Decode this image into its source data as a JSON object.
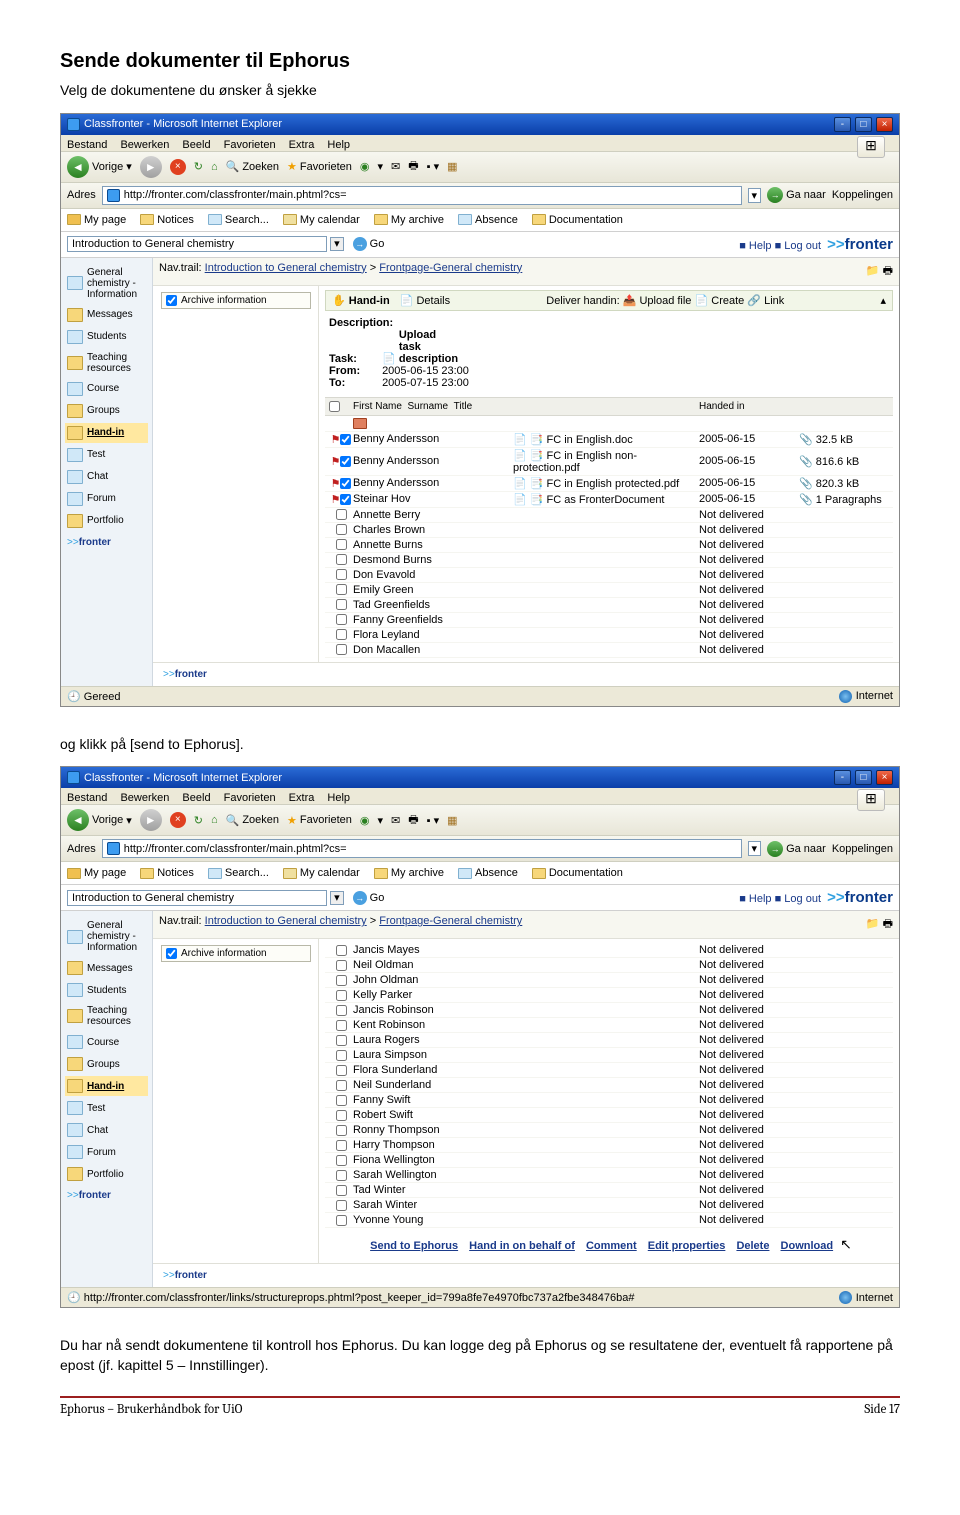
{
  "doc": {
    "title": "Sende dokumenter til  Ephorus",
    "intro": "Velg de dokumentene du ønsker å sjekke",
    "mid1": "og klikk på [send to Ephorus].",
    "outro": "Du har nå sendt dokumentene til kontroll hos Ephorus. Du kan logge deg på Ephorus og se resultatene der, eventuelt få rapportene på epost (jf. kapittel 5 – Innstillinger).",
    "foot_left": "Ephorus – Brukerhåndbok for UiO",
    "foot_right": "Side 17"
  },
  "browser": {
    "title": "Classfronter - Microsoft Internet Explorer",
    "menus": [
      "Bestand",
      "Bewerken",
      "Beeld",
      "Favorieten",
      "Extra",
      "Help"
    ],
    "back": "Vorige",
    "search": "Zoeken",
    "fav": "Favorieten",
    "addr_label": "Adres",
    "url": "http://fronter.com/classfronter/main.phtml?cs=",
    "url2": "http://fronter.com/classfronter/links/structureprops.phtml?post_keeper_id=799a8fe7e4970fbc737a2fbe348476ba#",
    "go": "Ga naar",
    "koppel": "Koppelingen",
    "status_left": "Gereed",
    "status_right": "Internet"
  },
  "fronter": {
    "nav": [
      "My page",
      "Notices",
      "Search...",
      "My calendar",
      "My archive",
      "Absence",
      "Documentation"
    ],
    "course": "Introduction to General chemistry",
    "go": "Go",
    "help": "Help",
    "logout": "Log out",
    "logo": "fronter",
    "navtrail_label": "Nav.trail:",
    "navtrail1": "Introduction to General chemistry",
    "navtrail2": "Frontpage-General chemistry",
    "archive": "Archive information"
  },
  "sidebar": [
    {
      "label": "General chemistry - Information",
      "ico": "alt"
    },
    {
      "label": "Messages",
      "ico": "f"
    },
    {
      "label": "Students",
      "ico": "alt"
    },
    {
      "label": "Teaching resources",
      "ico": "f"
    },
    {
      "label": "Course",
      "ico": "alt"
    },
    {
      "label": "Groups",
      "ico": "f"
    },
    {
      "label": "Hand-in",
      "ico": "hand"
    },
    {
      "label": "Test",
      "ico": "alt"
    },
    {
      "label": "Chat",
      "ico": "alt"
    },
    {
      "label": "Forum",
      "ico": "alt"
    },
    {
      "label": "Portfolio",
      "ico": "f"
    }
  ],
  "handin": {
    "title": "Hand-in",
    "details": "Details",
    "deliver": "Deliver handin:",
    "upload": "Upload file",
    "create": "Create",
    "link": "Link",
    "desc_label": "Description:",
    "task_label": "Task:",
    "task": "Upload task description",
    "from_label": "From:",
    "from": "2005-06-15 23:00",
    "to_label": "To:",
    "to": "2005-07-15 23:00",
    "cols": {
      "fn": "First Name",
      "sn": "Surname",
      "ti": "Title",
      "hi": "Handed in"
    }
  },
  "rows1": [
    {
      "ck": true,
      "flag": true,
      "name": "Benny Andersson",
      "title": "FC in English.doc",
      "date": "2005-06-15",
      "size": "32.5 kB"
    },
    {
      "ck": true,
      "flag": true,
      "name": "Benny Andersson",
      "title": "FC in English non-protection.pdf",
      "date": "2005-06-15",
      "size": "816.6 kB"
    },
    {
      "ck": true,
      "flag": true,
      "name": "Benny Andersson",
      "title": "FC in English protected.pdf",
      "date": "2005-06-15",
      "size": "820.3 kB"
    },
    {
      "ck": true,
      "flag": true,
      "name": "Steinar Hov",
      "title": "FC as FronterDocument",
      "date": "2005-06-15",
      "size": "1 Paragraphs"
    },
    {
      "ck": false,
      "name": "Annette Berry",
      "status": "Not delivered"
    },
    {
      "ck": false,
      "name": "Charles Brown",
      "status": "Not delivered"
    },
    {
      "ck": false,
      "name": "Annette Burns",
      "status": "Not delivered"
    },
    {
      "ck": false,
      "name": "Desmond Burns",
      "status": "Not delivered"
    },
    {
      "ck": false,
      "name": "Don Evavold",
      "status": "Not delivered"
    },
    {
      "ck": false,
      "name": "Emily Green",
      "status": "Not delivered"
    },
    {
      "ck": false,
      "name": "Tad Greenfields",
      "status": "Not delivered"
    },
    {
      "ck": false,
      "name": "Fanny Greenfields",
      "status": "Not delivered"
    },
    {
      "ck": false,
      "name": "Flora Leyland",
      "status": "Not delivered"
    },
    {
      "ck": false,
      "name": "Don Macallen",
      "status": "Not delivered"
    }
  ],
  "rows2": [
    {
      "name": "Jancis Mayes",
      "status": "Not delivered"
    },
    {
      "name": "Neil Oldman",
      "status": "Not delivered"
    },
    {
      "name": "John Oldman",
      "status": "Not delivered"
    },
    {
      "name": "Kelly Parker",
      "status": "Not delivered"
    },
    {
      "name": "Jancis Robinson",
      "status": "Not delivered"
    },
    {
      "name": "Kent Robinson",
      "status": "Not delivered"
    },
    {
      "name": "Laura Rogers",
      "status": "Not delivered"
    },
    {
      "name": "Laura Simpson",
      "status": "Not delivered"
    },
    {
      "name": "Flora Sunderland",
      "status": "Not delivered"
    },
    {
      "name": "Neil Sunderland",
      "status": "Not delivered"
    },
    {
      "name": "Fanny Swift",
      "status": "Not delivered"
    },
    {
      "name": "Robert Swift",
      "status": "Not delivered"
    },
    {
      "name": "Ronny Thompson",
      "status": "Not delivered"
    },
    {
      "name": "Harry Thompson",
      "status": "Not delivered"
    },
    {
      "name": "Fiona Wellington",
      "status": "Not delivered"
    },
    {
      "name": "Sarah Wellington",
      "status": "Not delivered"
    },
    {
      "name": "Tad Winter",
      "status": "Not delivered"
    },
    {
      "name": "Sarah Winter",
      "status": "Not delivered"
    },
    {
      "name": "Yvonne Young",
      "status": "Not delivered"
    }
  ],
  "actions": [
    "Send to Ephorus",
    "Hand in on behalf of",
    "Comment",
    "Edit properties",
    "Delete",
    "Download"
  ]
}
